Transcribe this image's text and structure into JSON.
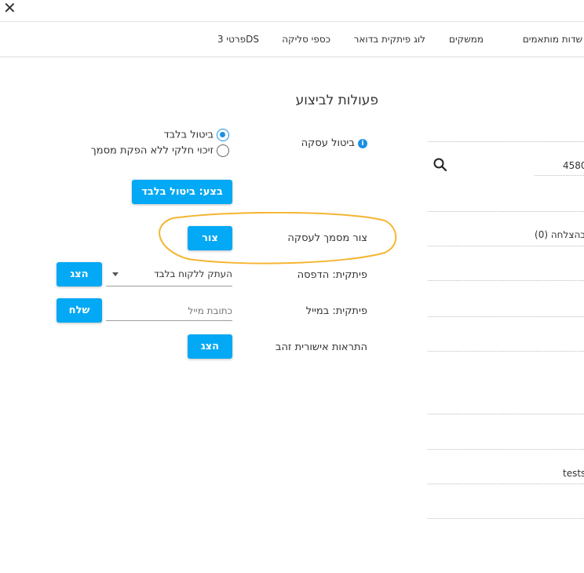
{
  "window": {
    "close_glyph": "✕"
  },
  "tabs": [
    "שדות מותאמים",
    "ממשקים",
    "לוג פיתקית בדואר",
    "כספי סליקה",
    "פרטי 3DS"
  ],
  "section_title": "פעולות לביצוע",
  "cancel": {
    "label": "ביטול עסקה",
    "info_glyph": "i",
    "options": [
      {
        "label": "ביטול בלבד",
        "selected": true
      },
      {
        "label": "זיכוי חלקי ללא הפקת מסמך",
        "selected": false
      }
    ],
    "execute_button": "בצע: ביטול בלבד"
  },
  "create_doc": {
    "label": "צור מסמך לעסקה",
    "button": "צור",
    "highlight_color": "#f5b531"
  },
  "print": {
    "label": "פיתקית: הדפסה",
    "select_value": "העתק ללקוח בלבד",
    "button": "הצג"
  },
  "email": {
    "label": "פיתקית: במייל",
    "placeholder": "כתובת מייל",
    "button": "שלח"
  },
  "gold": {
    "label": "התראות אישורית זהב",
    "button": "הצג"
  },
  "side": {
    "field_value": "4580",
    "status_text": "בהצלחה (0)",
    "last_value": "tests"
  },
  "colors": {
    "accent": "#03a9f4",
    "info": "#1a8fe3"
  }
}
